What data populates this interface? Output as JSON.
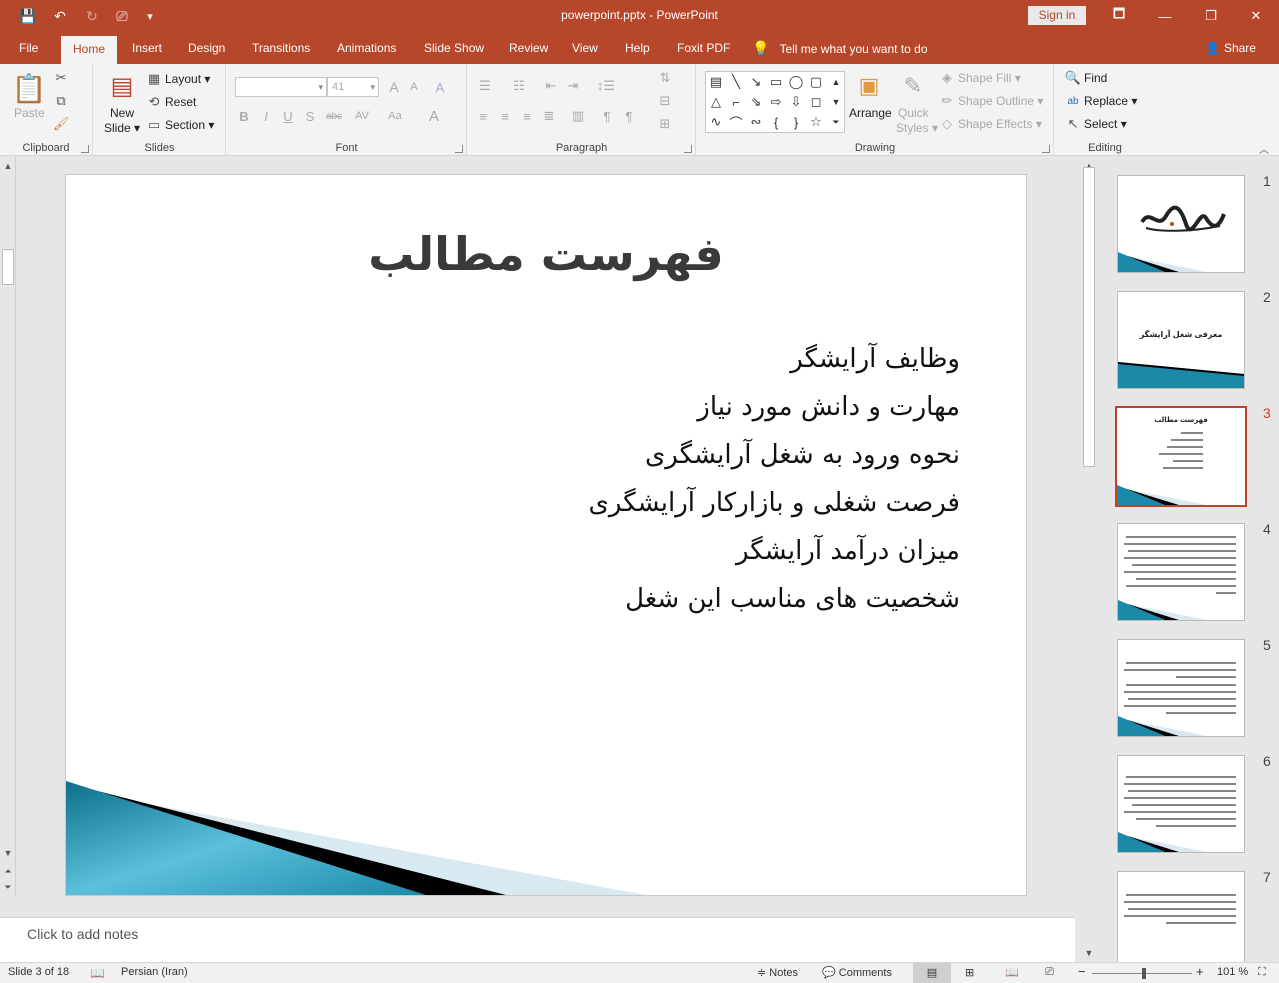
{
  "window": {
    "title": "powerpoint.pptx - PowerPoint",
    "signin_label": "Sign in",
    "controls": {
      "ribbon_options": "🗖",
      "minimize": "—",
      "restore": "❐",
      "close": "✕"
    }
  },
  "quick_access": {
    "save": "💾",
    "undo": "↶",
    "redo": "↻",
    "present": "⎚",
    "customize": "▾"
  },
  "tabs": [
    "File",
    "Home",
    "Insert",
    "Design",
    "Transitions",
    "Animations",
    "Slide Show",
    "Review",
    "View",
    "Help",
    "Foxit PDF"
  ],
  "active_tab": "Home",
  "tell_me": "Tell me what you want to do",
  "share_label": "Share",
  "ribbon": {
    "clipboard": {
      "label": "Clipboard",
      "paste": "Paste"
    },
    "slides": {
      "label": "Slides",
      "new_slide_line1": "New",
      "new_slide_line2": "Slide",
      "layout": "Layout",
      "reset": "Reset",
      "section": "Section"
    },
    "font": {
      "label": "Font",
      "font_name": "",
      "font_size": "41",
      "bold": "B",
      "italic": "I",
      "underline": "U",
      "shadow": "S",
      "strike": "abc",
      "spacing": "AV",
      "case": "Aa",
      "grow": "A",
      "shrink": "A",
      "clear": "A"
    },
    "paragraph": {
      "label": "Paragraph"
    },
    "drawing": {
      "label": "Drawing",
      "arrange": "Arrange",
      "quick_styles_line1": "Quick",
      "quick_styles_line2": "Styles",
      "shape_fill": "Shape Fill",
      "shape_outline": "Shape Outline",
      "shape_effects": "Shape Effects"
    },
    "editing": {
      "label": "Editing",
      "find": "Find",
      "replace": "Replace",
      "select": "Select"
    }
  },
  "slide": {
    "title": "فهرست مطالب",
    "bullets": [
      "وظایف آرایشگر",
      "مهارت و دانش مورد نیاز",
      "نحوه ورود به شغل آرایشگری",
      "فرصت شغلی و بازارکار آرایشگری",
      "میزان درآمد آرایشگر",
      "شخصیت های مناسب این شغل"
    ]
  },
  "notes_placeholder": "Click to add notes",
  "thumbnails": [
    {
      "number": "1",
      "text": ""
    },
    {
      "number": "2",
      "text": "معرفی شغل آرایشگر"
    },
    {
      "number": "3",
      "text": "فهرست مطالب"
    },
    {
      "number": "4",
      "text": ""
    },
    {
      "number": "5",
      "text": ""
    },
    {
      "number": "6",
      "text": ""
    },
    {
      "number": "7",
      "text": ""
    }
  ],
  "selected_thumbnail": 3,
  "status": {
    "slide_indicator": "Slide 3 of 18",
    "language": "Persian (Iran)",
    "notes": "Notes",
    "comments": "Comments",
    "zoom_minus": "−",
    "zoom_plus": "+",
    "zoom_level": "101 %",
    "zoom_value": 0.52
  },
  "colors": {
    "accent": "#b7472a",
    "selected": "#c0412c",
    "teal": "#1a8aa8"
  }
}
